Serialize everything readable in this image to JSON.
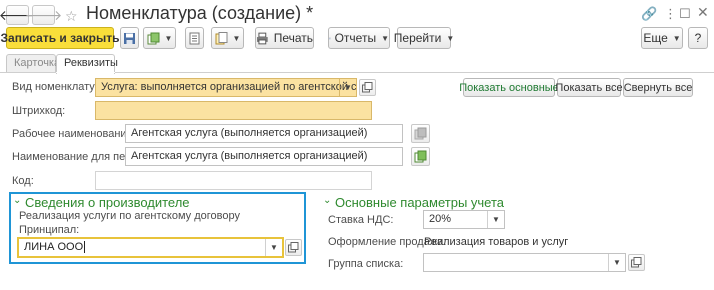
{
  "window": {
    "title": "Номенклатура (создание) *"
  },
  "toolbar": {
    "save_close": "Записать и закрыть",
    "print": "Печать",
    "reports": "Отчеты",
    "go_to": "Перейти",
    "more": "Еще",
    "help": "?"
  },
  "tabs": [
    {
      "label": "Карточка",
      "active": false
    },
    {
      "label": "Реквизиты",
      "active": true
    }
  ],
  "form": {
    "kind_label": "Вид номенклатуры:",
    "kind_value": "Услуга: выполняется организацией по агентской схем",
    "show_basic": "Показать основные",
    "show_all": "Показать все",
    "collapse_all": "Свернуть все",
    "barcode_label": "Штрихкод:",
    "barcode_value": "",
    "work_name_label": "Рабочее наименование:",
    "work_name_value": "Агентская услуга (выполняется организацией)",
    "print_name_label": "Наименование для печати:",
    "print_name_value": "Агентская услуга (выполняется организацией)",
    "code_label": "Код:",
    "code_value": ""
  },
  "manufacturer_section": {
    "title": "Сведения о производителе",
    "note": "Реализация услуги по агентскому договору",
    "principal_label": "Принципал:",
    "principal_value": "ЛИНА ООО"
  },
  "accounting_section": {
    "title": "Основные параметры учета",
    "vat_label": "Ставка НДС:",
    "vat_value": "20%",
    "sale_label": "Оформление продажи:",
    "sale_value": "Реализация товаров и услуг",
    "group_label": "Группа списка:",
    "group_value": ""
  },
  "colors": {
    "primary_button": "#f9de3a",
    "required_field": "#fbe2a1",
    "section_title": "#2f8a2f",
    "focus_frame": "#1f95d6",
    "active_input_border": "#e8c33b"
  }
}
